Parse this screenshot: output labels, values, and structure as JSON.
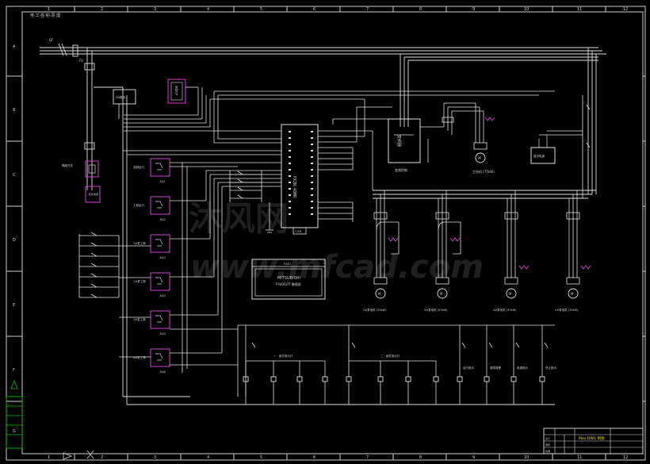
{
  "corner_label": "电·工·控·制·原·理",
  "border": {
    "top_numbers": [
      "1",
      "2",
      "3",
      "4",
      "5",
      "6",
      "7",
      "8",
      "9",
      "10",
      "11",
      "12"
    ],
    "bottom_numbers": [
      "1",
      "2",
      "3",
      "4",
      "5",
      "6",
      "7",
      "8",
      "9",
      "10",
      "11",
      "12"
    ],
    "side_letters": [
      "A",
      "B",
      "C",
      "D",
      "E",
      "F",
      "G"
    ]
  },
  "plc": {
    "model_label": "FX2N-48MR",
    "bottom_label": "COM"
  },
  "hmi": {
    "header": "F940",
    "brand": "MITSUBISHI",
    "subtitle": "F940GOT 触摸屏"
  },
  "modules": {
    "m1_label": "DA模块",
    "m2_label": "AD模块",
    "inverter_label": "变频器",
    "inverter_sub": "变频控制",
    "small_box_label": "直流电源"
  },
  "left_side": {
    "breaker_label": "QF",
    "fuse_label": "FU",
    "switch_label": "隔离开关",
    "power_box_label": "稳压电源"
  },
  "relays": [
    {
      "label": "KA1",
      "desc": "变频运行"
    },
    {
      "label": "KA2",
      "desc": "工频运行"
    },
    {
      "label": "KA3",
      "desc": "1#泵工频"
    },
    {
      "label": "KA4",
      "desc": "2#泵工频"
    },
    {
      "label": "KA5",
      "desc": "3#泵工频"
    },
    {
      "label": "KA6",
      "desc": "4#泵工频"
    }
  ],
  "motors": [
    {
      "label": "主电机 (75kW)"
    },
    {
      "label": "2#泵电机 (55kW)"
    },
    {
      "label": "3#泵电机 (55kW)"
    },
    {
      "label": "4#泵电机 (55kW)"
    },
    {
      "label": "5#泵电机 (55kW)"
    }
  ],
  "lower_groups": [
    {
      "label": "一 · 组件指示灯"
    },
    {
      "label": "二 · 组件指示灯"
    },
    {
      "label": "运行指示"
    },
    {
      "label": "故障报警"
    },
    {
      "label": "电源指示"
    },
    {
      "label": "停止指示"
    }
  ],
  "title_block": {
    "title": "Max.DWG 制图",
    "rows": [
      "设计",
      "审核",
      "批准"
    ]
  },
  "watermark": {
    "line1": "沐风网",
    "line2": "www.mfcad.com"
  }
}
